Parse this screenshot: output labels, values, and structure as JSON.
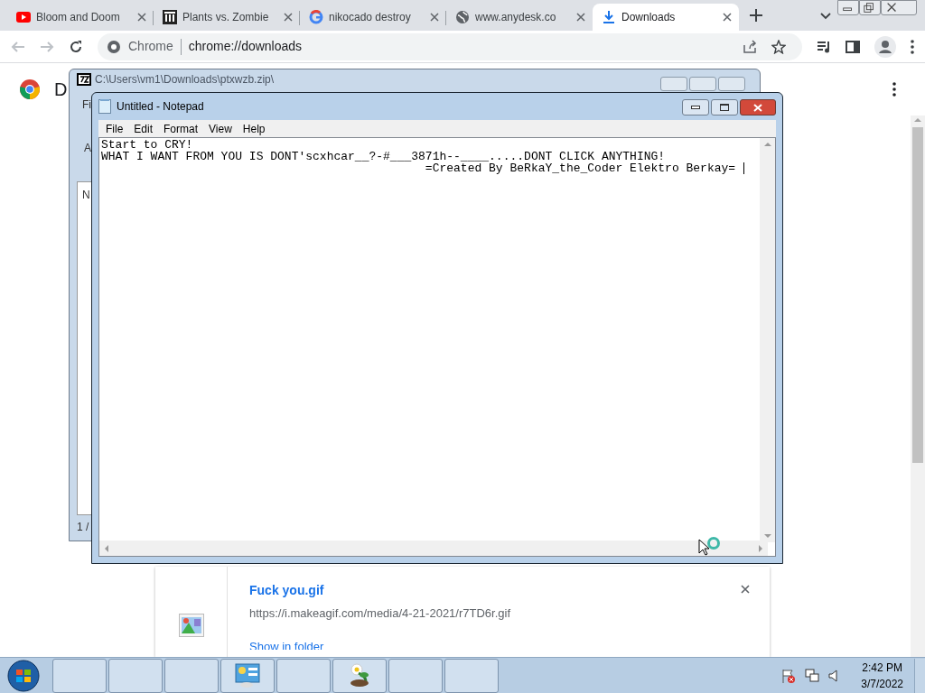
{
  "browser": {
    "tabs": [
      {
        "title": "Bloom and Doom",
        "kind": "youtube",
        "selected": false
      },
      {
        "title": "Plants vs. Zombie",
        "kind": "museum",
        "selected": false
      },
      {
        "title": "nikocado destroy",
        "kind": "google",
        "selected": false
      },
      {
        "title": "www.anydesk.co",
        "kind": "globe",
        "selected": false
      },
      {
        "title": "Downloads",
        "kind": "download",
        "selected": true
      }
    ],
    "site_chip": "Chrome",
    "address": "chrome://downloads"
  },
  "page": {
    "title_fragment": "D",
    "download": {
      "filename": "Fuck you.gif",
      "url": "https://i.makeagif.com/media/4-21-2021/r7TD6r.gif",
      "action": "Show in folder"
    }
  },
  "archive_window": {
    "title": "C:\\Users\\vm1\\Downloads\\ptxwzb.zip\\",
    "fragments": [
      "Fi",
      "A",
      "N",
      "1 /"
    ]
  },
  "notepad": {
    "title": "Untitled - Notepad",
    "menu": [
      "File",
      "Edit",
      "Format",
      "View",
      "Help"
    ],
    "lines": [
      "Start to CRY!",
      "WHAT I WANT FROM YOU IS DONT'scxhcar__?-#___3871h--____.....DONT CLICK ANYTHING!",
      "                                              =Created By BeRkaY_the_Coder Elektro Berkay= "
    ]
  },
  "taskbar": {
    "buttons": [
      {
        "kind": "blank"
      },
      {
        "kind": "blank"
      },
      {
        "kind": "blank"
      },
      {
        "kind": "panel"
      },
      {
        "kind": "blank"
      },
      {
        "kind": "plant"
      },
      {
        "kind": "blank"
      },
      {
        "kind": "blank"
      }
    ],
    "time": "2:42 PM",
    "date": "3/7/2022"
  }
}
